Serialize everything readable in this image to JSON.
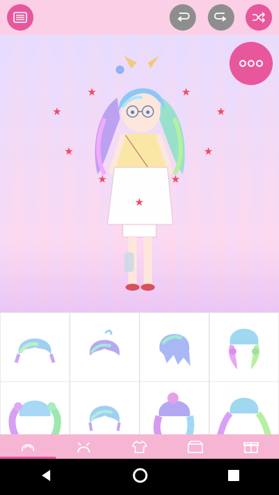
{
  "topbar": {
    "buttons": [
      {
        "icon": "list-menu-icon"
      },
      {
        "icon": "undo-icon"
      },
      {
        "icon": "redo-icon"
      },
      {
        "icon": "shuffle-icon"
      }
    ]
  },
  "stage": {
    "more_button_icon": "three-dots-icon"
  },
  "item_grid": {
    "items": [
      {
        "icon": "hair-style-1-icon"
      },
      {
        "icon": "hair-style-2-icon"
      },
      {
        "icon": "hair-style-3-icon"
      },
      {
        "icon": "hair-style-4-icon"
      },
      {
        "icon": "hair-style-5-icon"
      },
      {
        "icon": "hair-style-6-icon"
      },
      {
        "icon": "hair-style-7-icon"
      },
      {
        "icon": "hair-style-8-icon"
      }
    ]
  },
  "tabs": [
    {
      "icon": "hair-tab-icon",
      "active": true
    },
    {
      "icon": "accessory-tab-icon",
      "active": false
    },
    {
      "icon": "clothes-tab-icon",
      "active": false
    },
    {
      "icon": "background-tab-icon",
      "active": false
    },
    {
      "icon": "gift-tab-icon",
      "active": false
    }
  ],
  "navbar": {
    "buttons": [
      "back-icon",
      "home-icon",
      "recents-icon"
    ]
  },
  "colors": {
    "accent": "#e8579c",
    "topbar": "#fbd0e6",
    "tabbar": "#f6b6d3",
    "grey_button": "#8e8e8e"
  }
}
